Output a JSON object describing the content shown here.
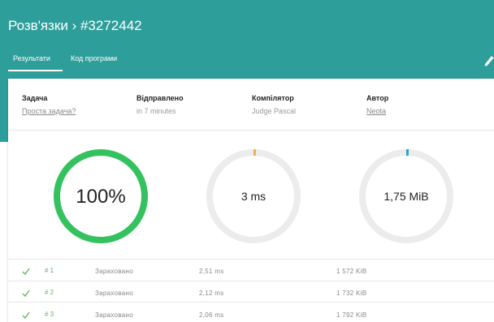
{
  "header": {
    "title": "Розв'язки › #3272442",
    "tabs": [
      {
        "label": "Результати",
        "active": true
      },
      {
        "label": "Код програми",
        "active": false
      }
    ],
    "background": "#2e9e9b"
  },
  "info": {
    "task_label": "Задача",
    "task_value": "Проста задача?",
    "sent_label": "Відправлено",
    "sent_value": "in 7 minutes",
    "compiler_label": "Компілятор",
    "compiler_value": "Judge Pascal",
    "author_label": "Автор",
    "author_value": "Neota"
  },
  "gauges": [
    {
      "label": "100%",
      "fraction": 1.0,
      "color": "#33c25e"
    },
    {
      "label": "3 ms",
      "fraction": 0.005,
      "color": "#f0ad4e"
    },
    {
      "label": "1,75 MiB",
      "fraction": 0.005,
      "color": "#1fa3d6"
    }
  ],
  "tests": [
    {
      "id": "# 1",
      "status": "Зараховано",
      "time": "2,51 ms",
      "memory": "1 572 KiB"
    },
    {
      "id": "# 2",
      "status": "Зараховано",
      "time": "2,12 ms",
      "memory": "1 732 KiB"
    },
    {
      "id": "# 3",
      "status": "Зараховано",
      "time": "2,06 ms",
      "memory": "1 792 KiB"
    }
  ],
  "icons": {
    "edit": "pencil-icon",
    "passed": "checkmark-icon"
  }
}
